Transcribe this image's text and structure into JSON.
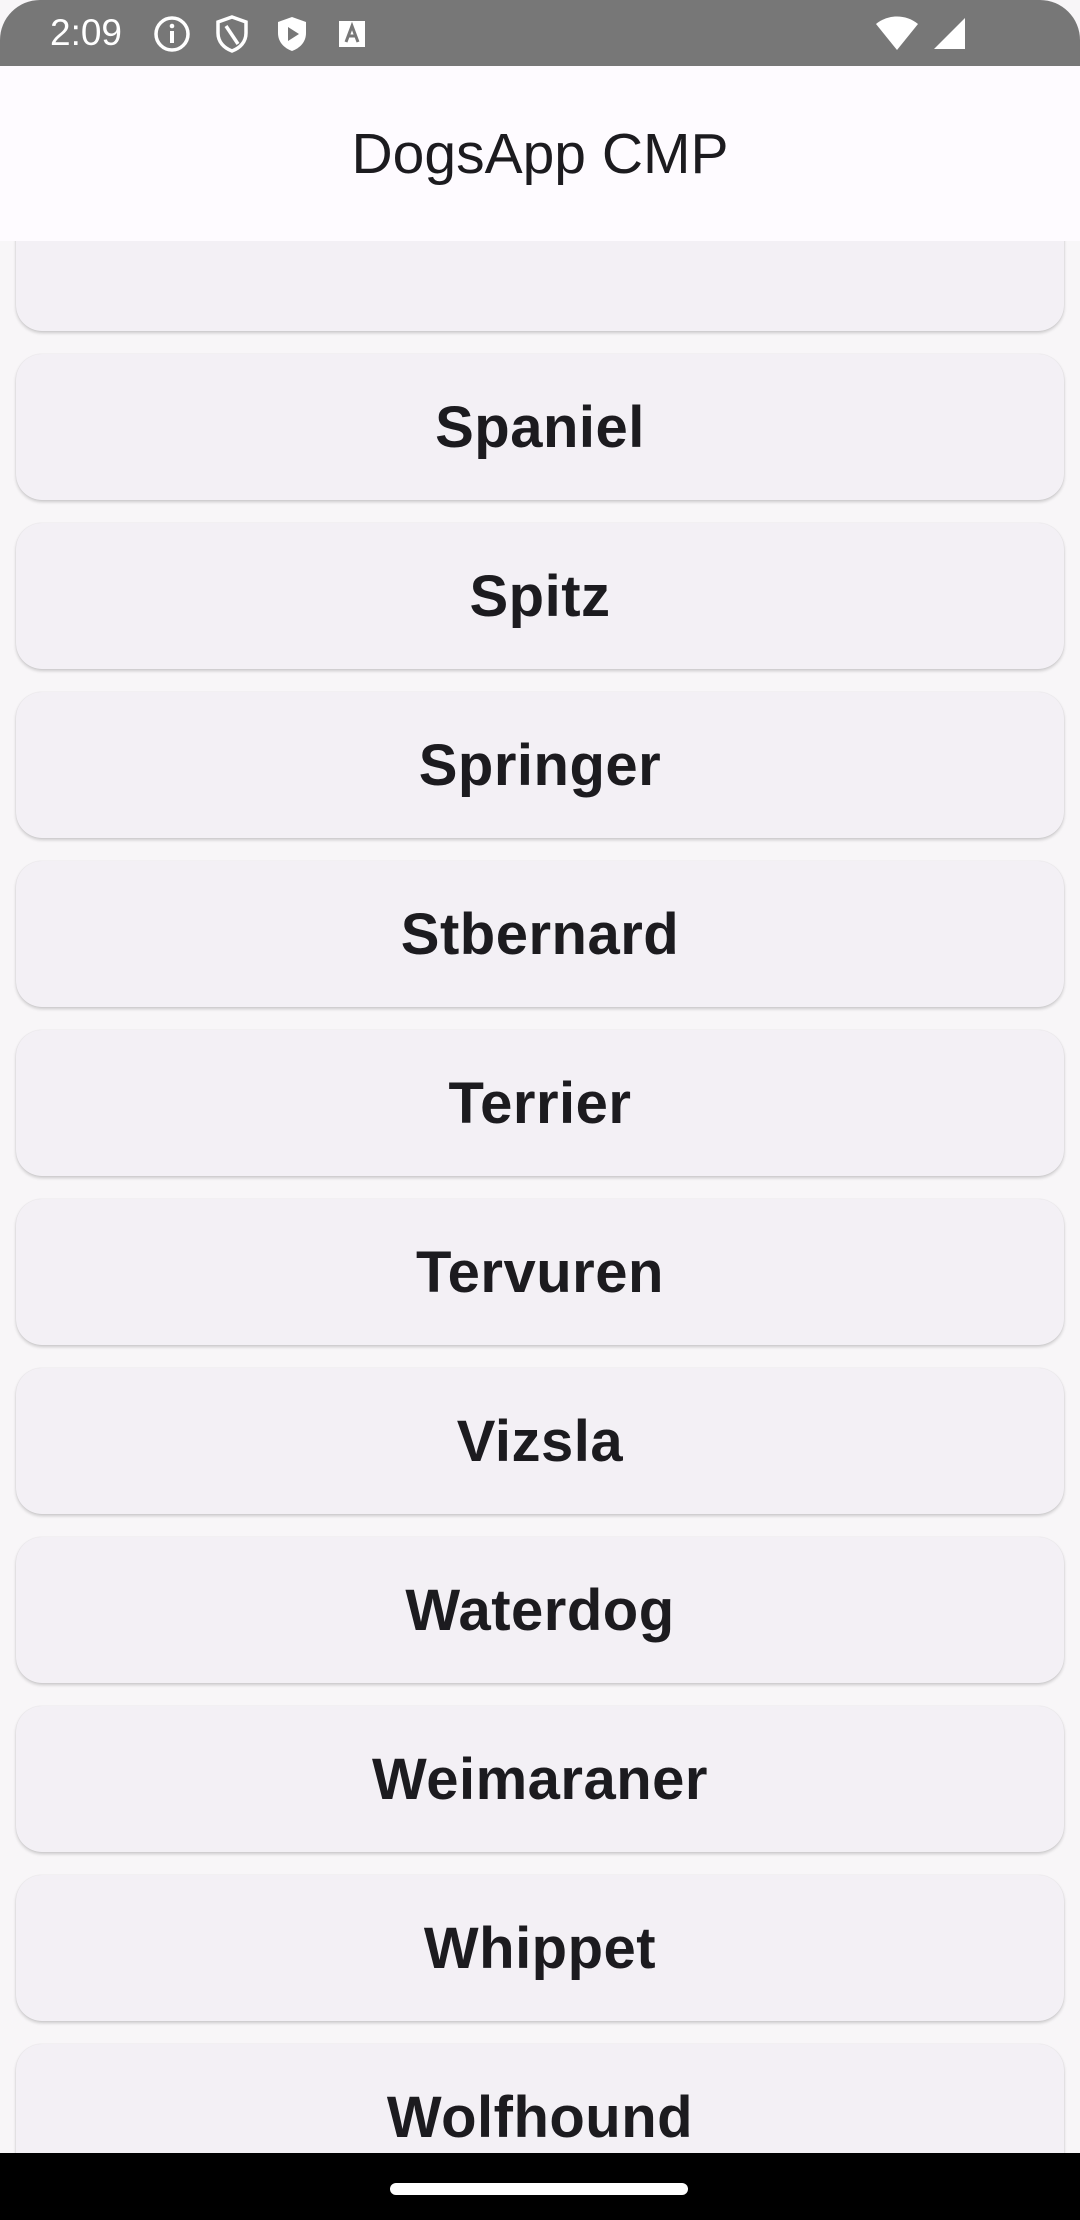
{
  "status_bar": {
    "time": "2:09",
    "left_icons": [
      "info-icon",
      "shield-icon",
      "play-shield-icon",
      "font-a-icon"
    ],
    "right_icons": [
      "wifi-icon",
      "signal-icon"
    ],
    "background": "#777777"
  },
  "app_bar": {
    "title": "DogsApp CMP"
  },
  "breed_list": {
    "items": [
      {
        "label": ""
      },
      {
        "label": "Spaniel"
      },
      {
        "label": "Spitz"
      },
      {
        "label": "Springer"
      },
      {
        "label": "Stbernard"
      },
      {
        "label": "Terrier"
      },
      {
        "label": "Tervuren"
      },
      {
        "label": "Vizsla"
      },
      {
        "label": "Waterdog"
      },
      {
        "label": "Weimaraner"
      },
      {
        "label": "Whippet"
      },
      {
        "label": "Wolfhound"
      }
    ],
    "card_color": "#f3f0f5",
    "text_color": "#1c1b1f"
  },
  "nav_bar": {
    "background": "#000000"
  }
}
